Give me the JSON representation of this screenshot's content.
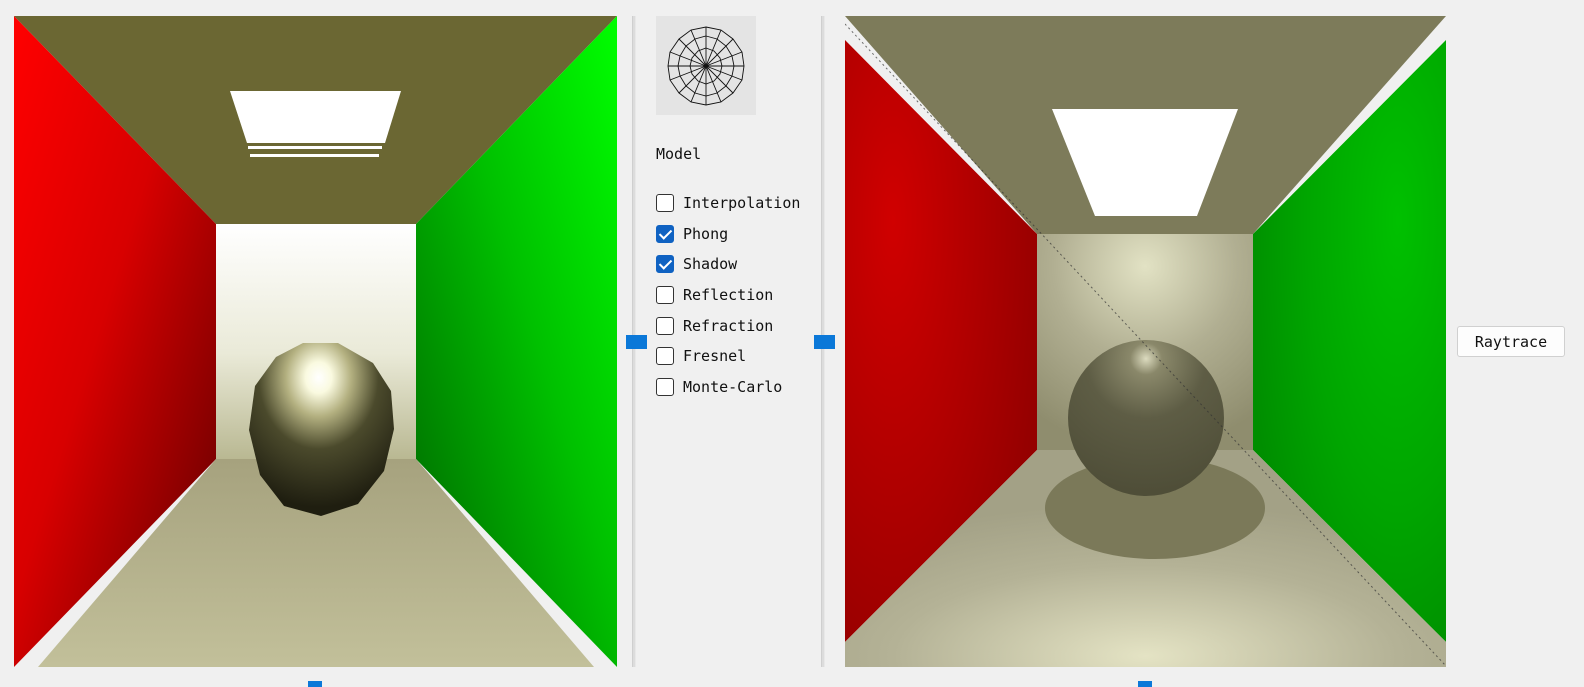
{
  "panel": {
    "model_label": "Model",
    "options": [
      {
        "label": "Interpolation",
        "checked": false
      },
      {
        "label": "Phong",
        "checked": true
      },
      {
        "label": "Shadow",
        "checked": true
      },
      {
        "label": "Reflection",
        "checked": false
      },
      {
        "label": "Refraction",
        "checked": false
      },
      {
        "label": "Fresnel",
        "checked": false
      },
      {
        "label": "Monte-Carlo",
        "checked": false
      }
    ]
  },
  "actions": {
    "raytrace_label": "Raytrace"
  },
  "icons": {
    "model_preview": "sphere-wireframe-icon"
  },
  "colors": {
    "splitter_handle": "#0b78d8",
    "checkbox_checked": "#0f62c2",
    "left_wall": "#ff0000",
    "right_wall": "#00ff00",
    "ceiling_left": "#6b6733",
    "ceiling_right": "#7d7b5a"
  }
}
